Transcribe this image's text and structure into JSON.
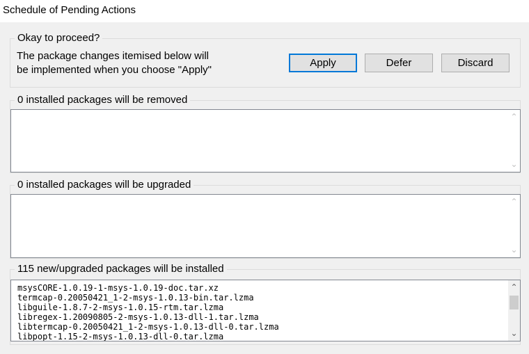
{
  "window": {
    "title": "Schedule of Pending Actions"
  },
  "proceed": {
    "heading": "Okay to proceed?",
    "description_line1": "The package changes itemised below will",
    "description_line2": "be implemented when you choose \"Apply\"",
    "buttons": {
      "apply": "Apply",
      "defer": "Defer",
      "discard": "Discard"
    }
  },
  "removed": {
    "heading": "0 installed packages will be removed",
    "items": []
  },
  "upgraded": {
    "heading": "0 installed packages will be upgraded",
    "items": []
  },
  "installed": {
    "heading": "115 new/upgraded packages will be installed",
    "items": [
      "msysCORE-1.0.19-1-msys-1.0.19-doc.tar.xz",
      "termcap-0.20050421_1-2-msys-1.0.13-bin.tar.lzma",
      "libguile-1.8.7-2-msys-1.0.15-rtm.tar.lzma",
      "libregex-1.20090805-2-msys-1.0.13-dll-1.tar.lzma",
      "libtermcap-0.20050421_1-2-msys-1.0.13-dll-0.tar.lzma",
      "libpopt-1.15-2-msys-1.0.13-dll-0.tar.lzma"
    ]
  },
  "icons": {
    "scroll_up": "chevron-up-icon",
    "scroll_down": "chevron-down-icon"
  }
}
